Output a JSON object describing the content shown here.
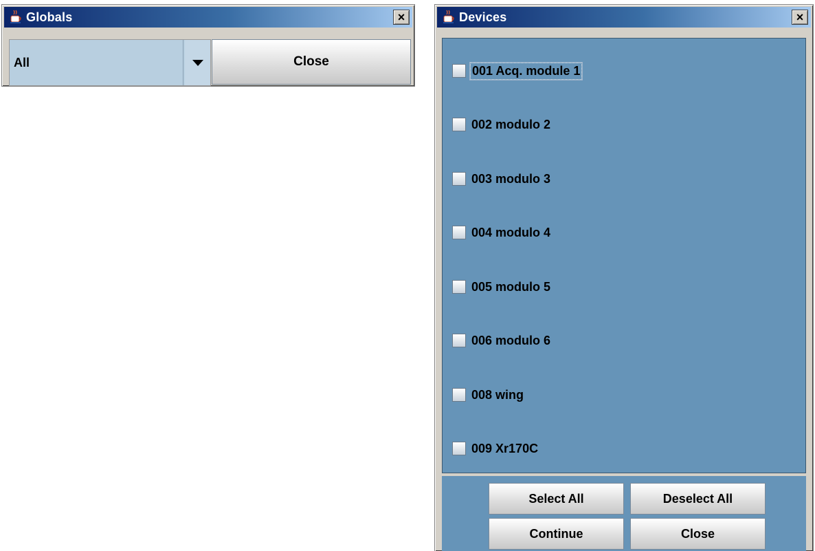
{
  "globals_window": {
    "title": "Globals",
    "close_glyph": "×",
    "combo_value": "All",
    "close_button": "Close"
  },
  "devices_window": {
    "title": "Devices",
    "close_glyph": "×",
    "devices": [
      {
        "label": "001 Acq. module 1",
        "checked": false
      },
      {
        "label": "002 modulo 2",
        "checked": false
      },
      {
        "label": "003 modulo 3",
        "checked": false
      },
      {
        "label": "004 modulo 4",
        "checked": false
      },
      {
        "label": "005 modulo 5",
        "checked": false
      },
      {
        "label": "006 modulo 6",
        "checked": false
      },
      {
        "label": "008 wing",
        "checked": false
      },
      {
        "label": "009 Xr170C",
        "checked": false
      }
    ],
    "buttons": {
      "select_all": "Select All",
      "deselect_all": "Deselect All",
      "continue": "Continue",
      "close": "Close"
    }
  },
  "colors": {
    "title_gradient_start": "#0a246a",
    "title_gradient_end": "#a6caf0",
    "panel_blue": "#6694b8",
    "window_gray": "#d4d0c8"
  },
  "icons": [
    "java-cup-icon",
    "close-icon",
    "dropdown-arrow-icon"
  ]
}
